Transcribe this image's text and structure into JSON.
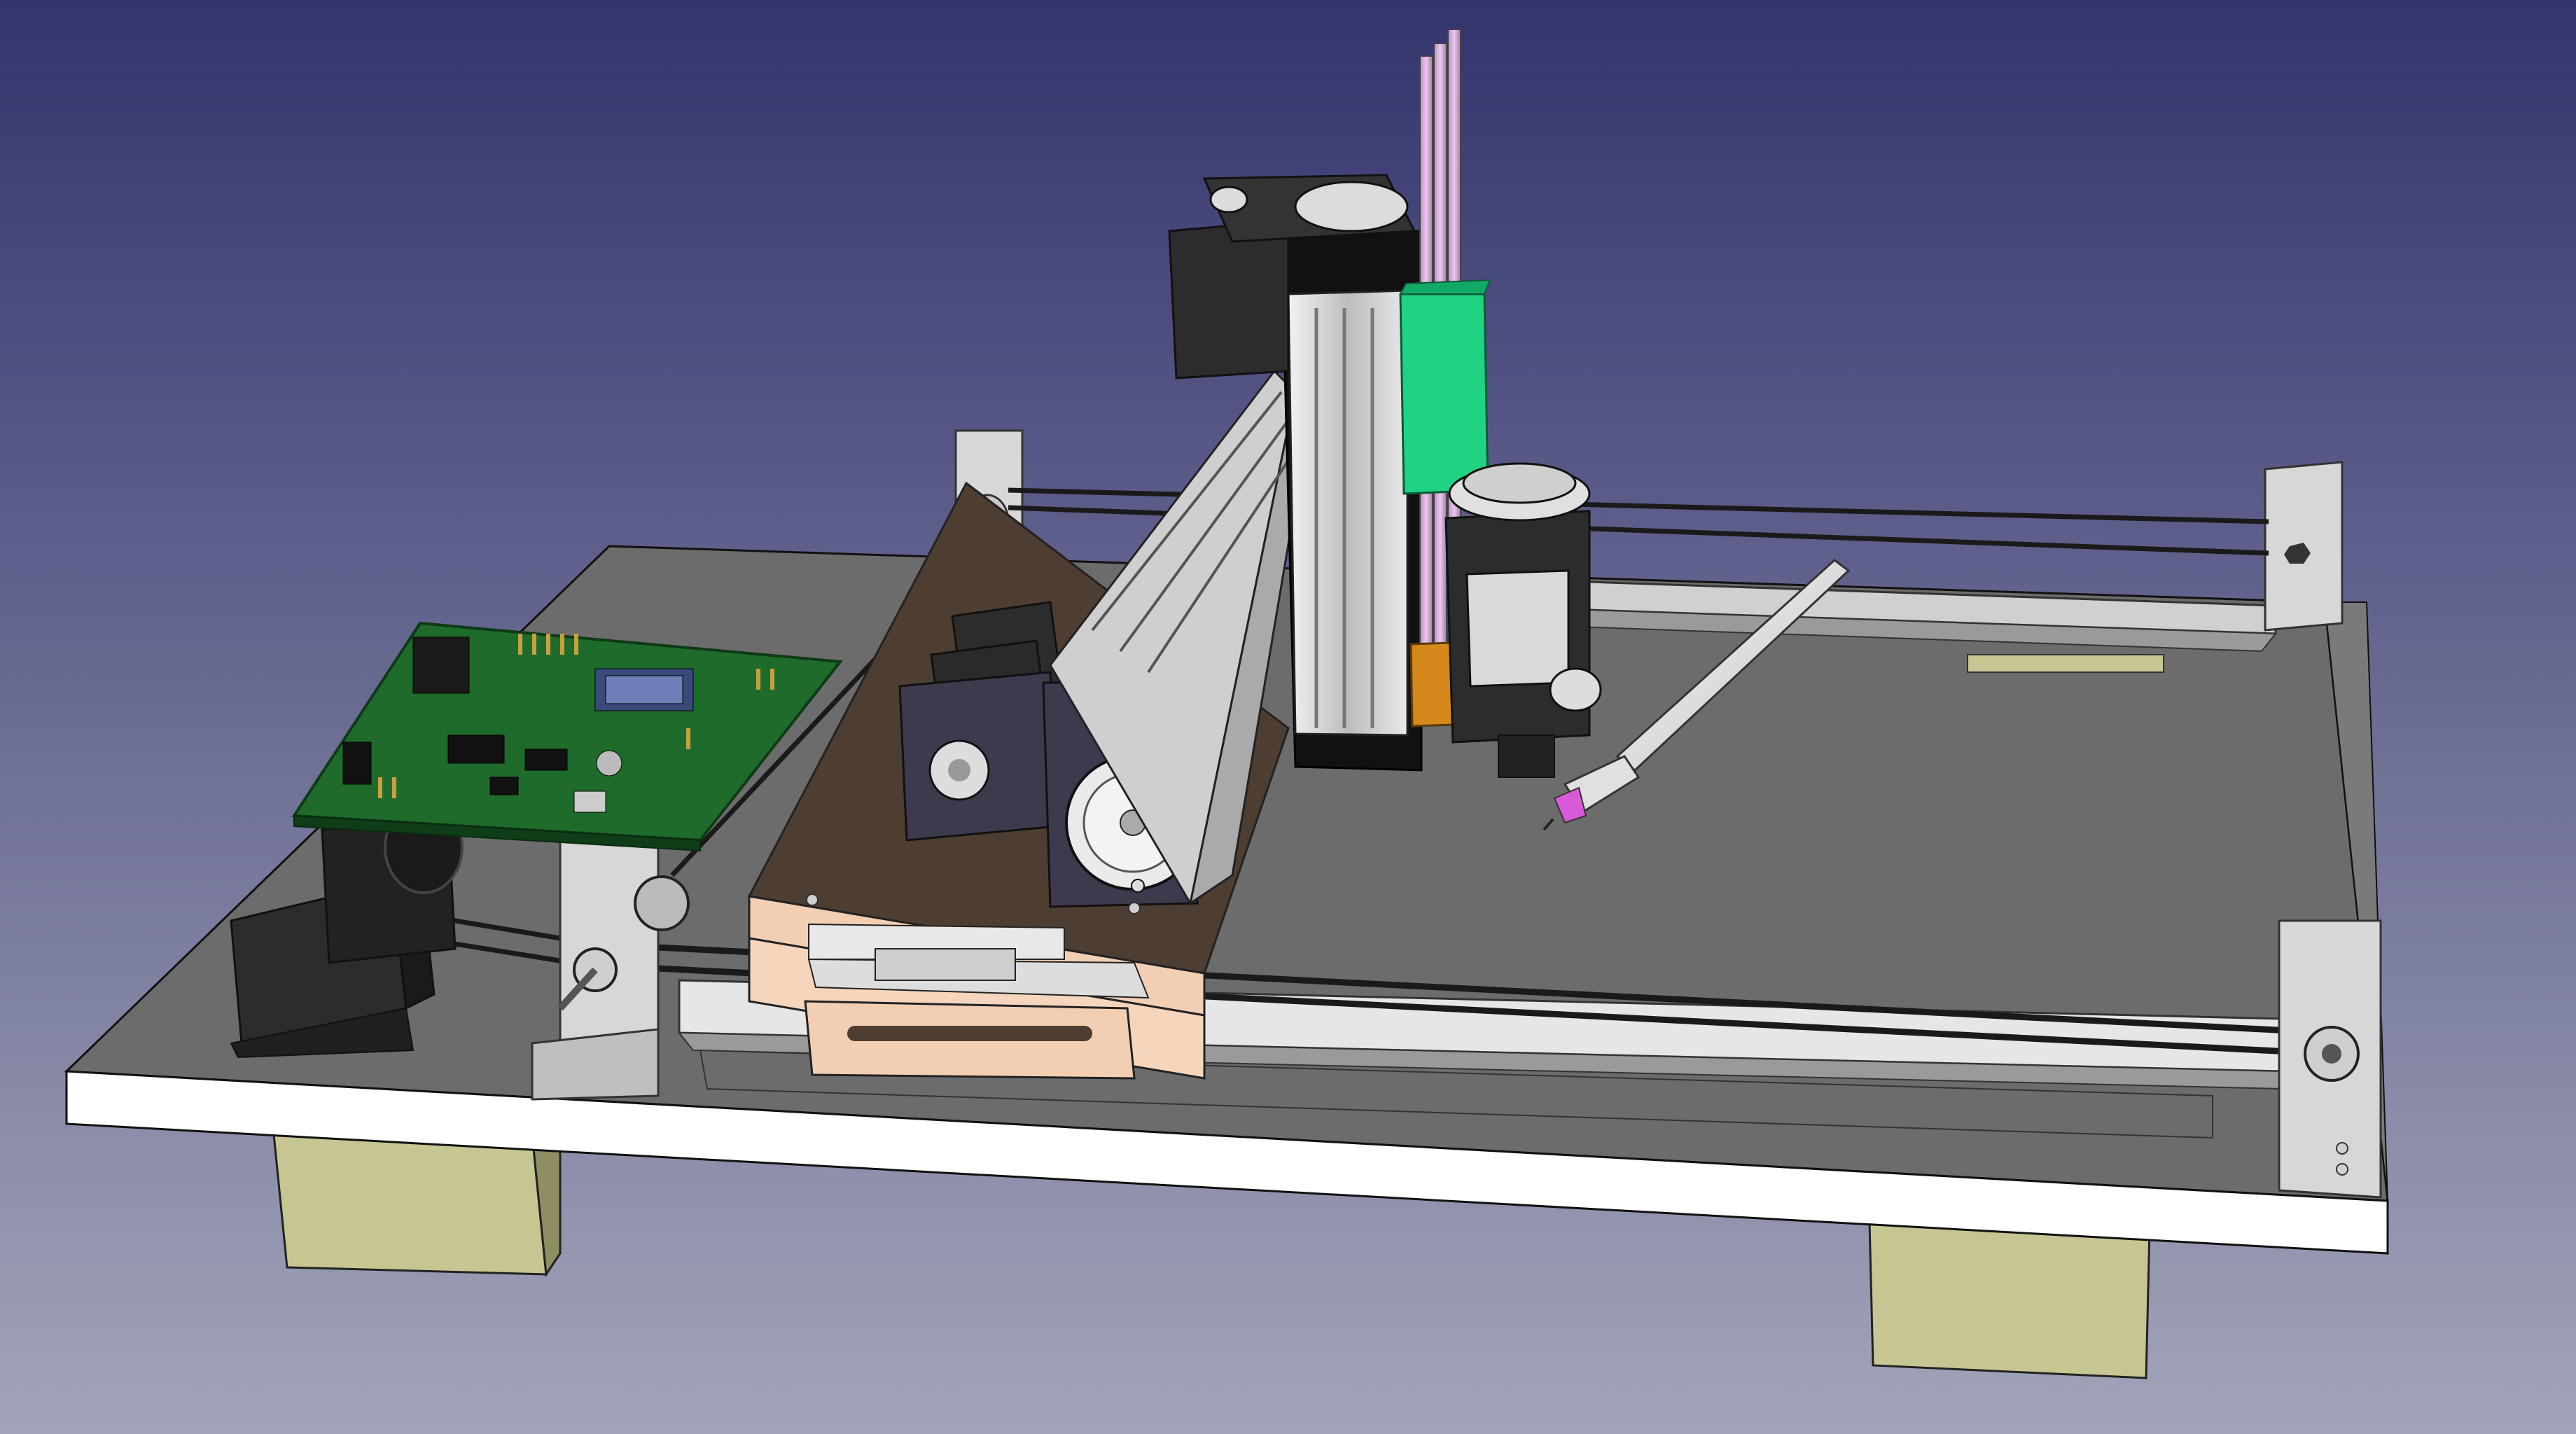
{
  "viewport": {
    "background_gradient": {
      "top": "#34346e",
      "bottom": "#a2a5b9"
    },
    "interaction": "3d-orbit"
  },
  "colors": {
    "base_top": "#6c6c6c",
    "base_edge": "#ffffff",
    "feet": "#c7c693",
    "aluminum": "#d0d0d0",
    "aluminum_dark": "#8e8e8e",
    "carriage_wood": "#4e3d31",
    "carriage_light": "#f2cfb3",
    "motor": "#2c2c2c",
    "motor_plate": "#3d3a4e",
    "pcb": "#1f6b2c",
    "z_block_green": "#1fd383",
    "z_block_orange": "#d4891a",
    "guide_rods": "#d4a8d8",
    "belt": "#1a1a1a",
    "pen_tip": "#d85ad8"
  },
  "model_parts": [
    "base-board",
    "support-foot-left",
    "support-foot-right",
    "controller-pcb",
    "y-stepper-motor",
    "x-stepper-motor",
    "z-stepper-motor",
    "gantry-carriage",
    "x-rail-beam",
    "z-column",
    "z-guide-rods",
    "pen-holder",
    "pen",
    "front-rail",
    "rear-rail",
    "drive-belts",
    "belt-idler-brackets"
  ]
}
